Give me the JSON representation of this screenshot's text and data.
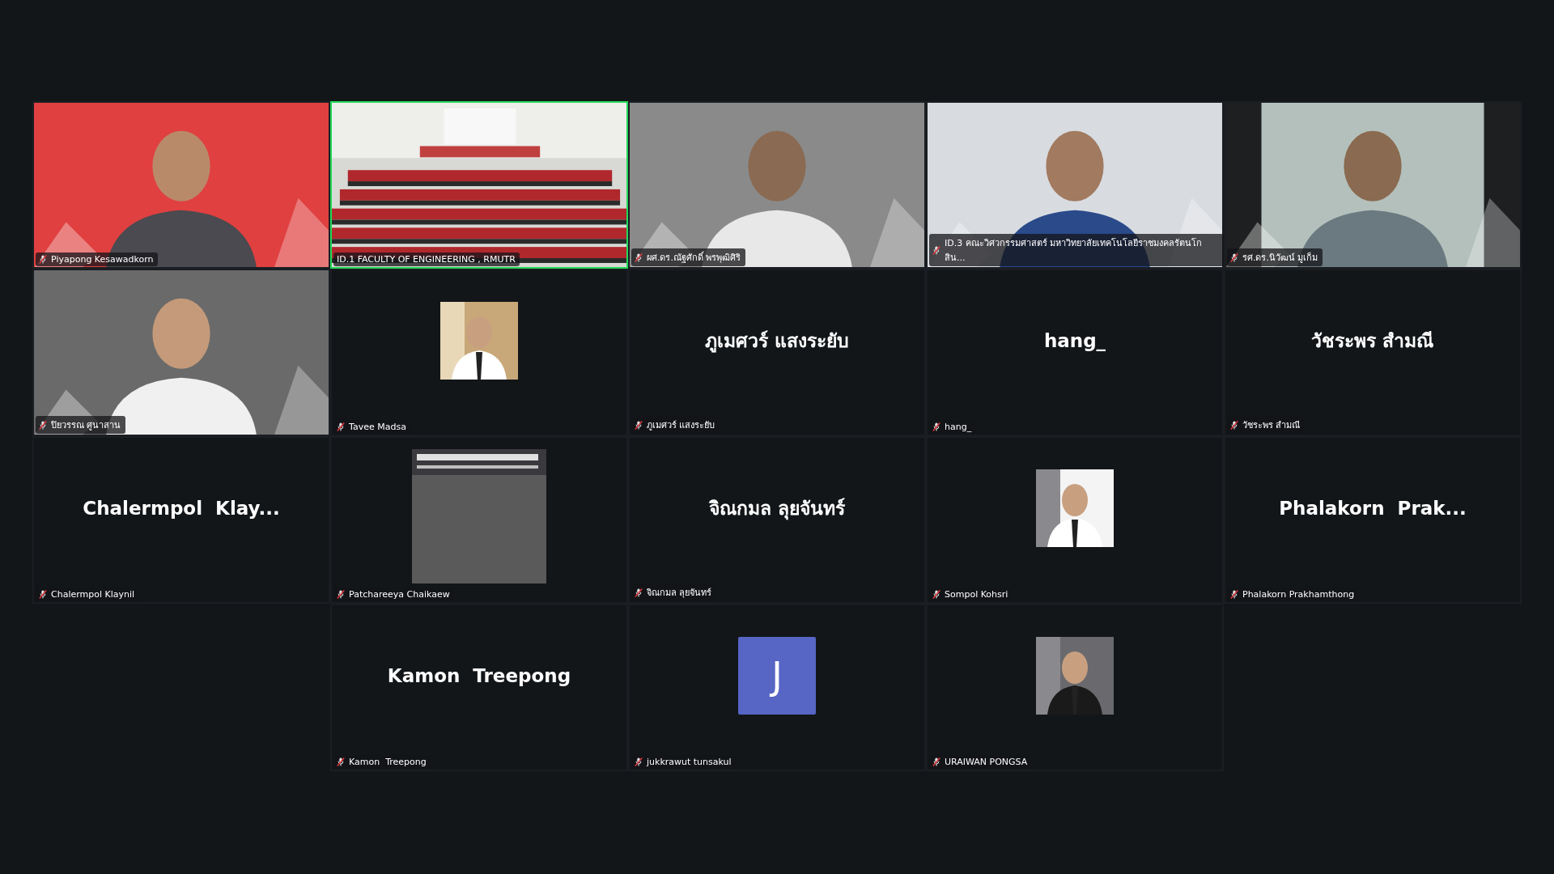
{
  "tiles": [
    {
      "kind": "video",
      "name": "Piyapong Kesawadkorn",
      "muted": true,
      "speaking": false
    },
    {
      "kind": "video",
      "name": "ID.1 FACULTY OF ENGINEERING , RMUTR",
      "muted": false,
      "speaking": true
    },
    {
      "kind": "video",
      "name": "ผศ.ดร.ณัฐศักดิ์ พรพุฒิศิริ",
      "muted": true,
      "speaking": false
    },
    {
      "kind": "video",
      "name": "ID.3 คณะวิศวกรรมศาสตร์ มหาวิทยาลัยเทคโนโลยีราชมงคลรัตนโกสิน...",
      "muted": true,
      "speaking": false
    },
    {
      "kind": "video",
      "name": "รศ.ดร.นิวัฒน์ มูเก็ม",
      "muted": true,
      "speaking": false
    },
    {
      "kind": "video",
      "name": "ปิยวรรณ ศูนาสาน",
      "muted": true,
      "speaking": false
    },
    {
      "name": "Tavee Madsa",
      "muted": true,
      "speaking": false
    },
    {
      "kind": "name",
      "display": "ภูเมศวร์ แสงระยับ",
      "name": "ภูเมศวร์ แสงระยับ",
      "muted": true,
      "speaking": false
    },
    {
      "kind": "name",
      "display": "hang_",
      "name": "hang_",
      "muted": true,
      "speaking": false
    },
    {
      "kind": "name",
      "display": "วัชระพร สำมณี",
      "name": "วัชระพร สำมณี",
      "muted": true,
      "speaking": false
    },
    {
      "kind": "name",
      "display": "Chalermpol  Klay...",
      "name": "Chalermpol Klaynil",
      "muted": true,
      "speaking": false
    },
    {
      "kind": "banner",
      "name": "Patchareeya Chaikaew",
      "muted": true,
      "speaking": false
    },
    {
      "kind": "name",
      "display": "จิณกมล ลุยจันทร์",
      "name": "จิณกมล ลุยจันทร์",
      "muted": true,
      "speaking": false
    },
    {
      "name": "Sompol Kohsri",
      "muted": true,
      "speaking": false
    },
    {
      "kind": "name",
      "display": "Phalakorn  Prak...",
      "name": "Phalakorn Prakhamthong",
      "muted": true,
      "speaking": false
    },
    {
      "kind": "name",
      "display": "Kamon  Treepong",
      "name": "Kamon  Treepong",
      "muted": true,
      "speaking": false
    },
    {
      "kind": "letter",
      "display": "J",
      "name": "jukkrawut tunsakul",
      "muted": true,
      "speaking": false
    },
    {
      "name": "URAIWAN PONGSA",
      "muted": true,
      "speaking": false
    }
  ]
}
